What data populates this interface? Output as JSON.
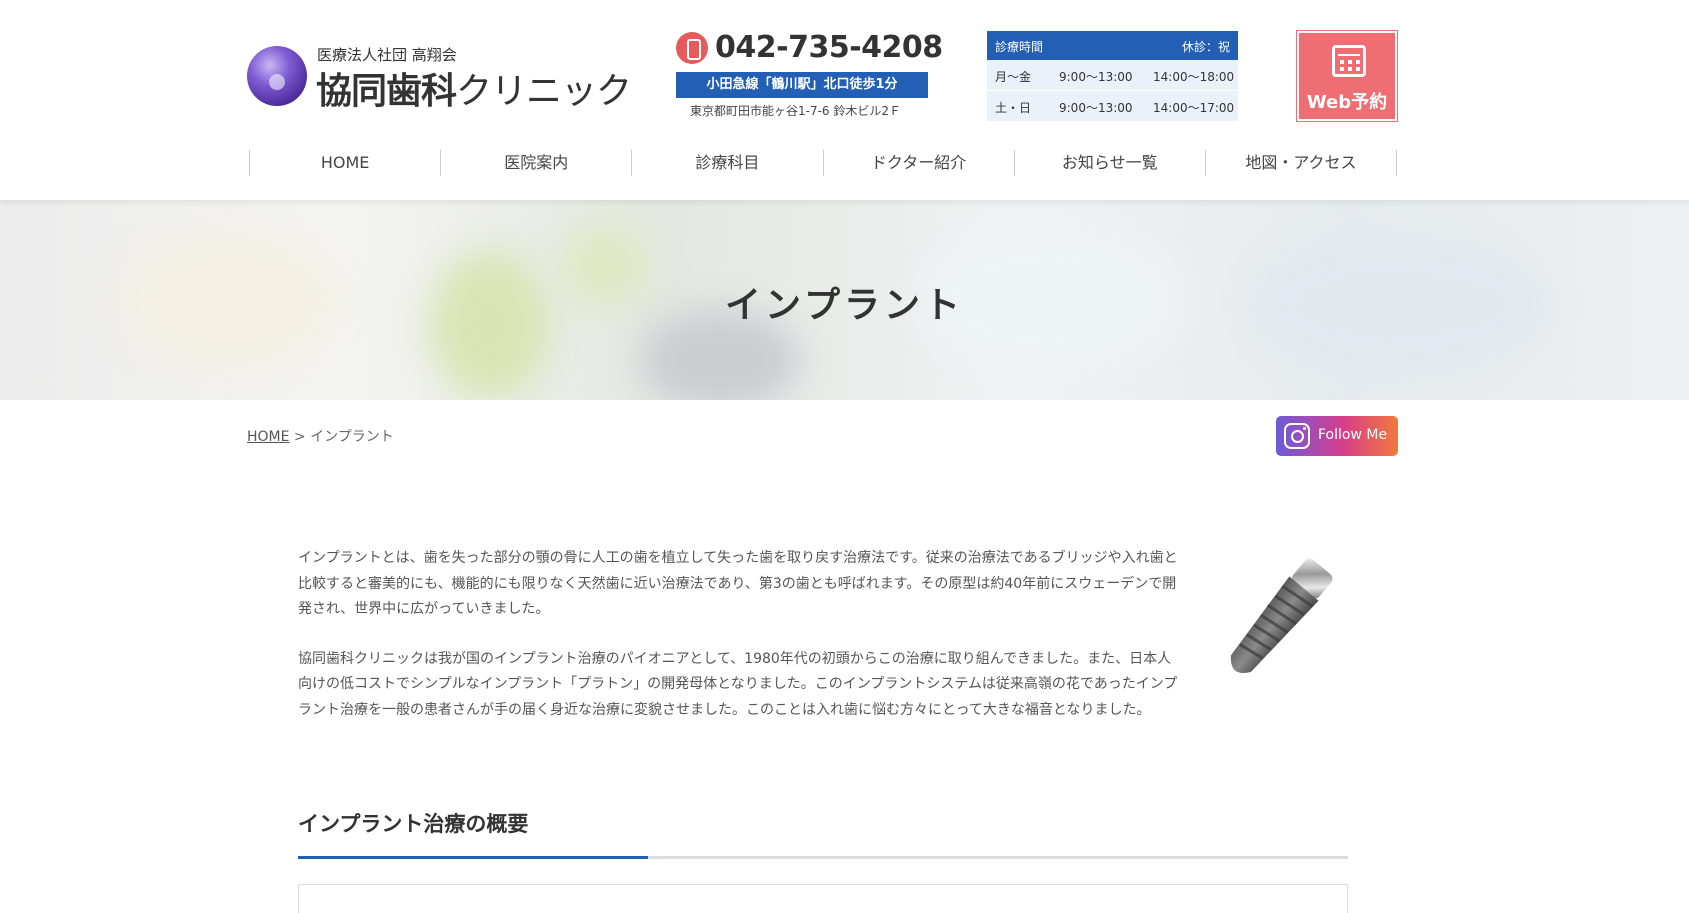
{
  "header": {
    "logo": {
      "corporation": "医療法人社団 高翔会",
      "name_bold": "協同歯科",
      "name_light": "クリニック"
    },
    "phone": "042-735-4208",
    "station": "小田急線「鶴川駅」北口徒歩1分",
    "address": "東京都町田市能ヶ谷1-7-6 鈴木ビル2Ｆ",
    "hours": {
      "label": "診療時間",
      "closed": "休診：祝",
      "rows": [
        {
          "days": "月～金",
          "morning": "9:00～13:00",
          "afternoon": "14:00～18:00"
        },
        {
          "days": "土・日",
          "morning": "9:00～13:00",
          "afternoon": "14:00～17:00"
        }
      ]
    },
    "web_reserve": "Web予約",
    "nav": [
      "HOME",
      "医院案内",
      "診療科目",
      "ドクター紹介",
      "お知らせ一覧",
      "地図・アクセス"
    ]
  },
  "hero": {
    "title": "インプラント"
  },
  "breadcrumb": {
    "home": "HOME",
    "separator": " > ",
    "current": "インプラント"
  },
  "instagram": {
    "label": "Follow Me"
  },
  "intro": {
    "paragraphs": [
      "インプラントとは、歯を失った部分の顎の骨に人工の歯を植立して失った歯を取り戻す治療法です。従来の治療法であるブリッジや入れ歯と比較すると審美的にも、機能的にも限りなく天然歯に近い治療法であり、第3の歯とも呼ばれます。その原型は約40年前にスウェーデンで開発され、世界中に広がっていきました。",
      "協同歯科クリニックは我が国のインプラント治療のパイオニアとして、1980年代の初頭からこの治療に取り組んできました。また、日本人向けの低コストでシンプルなインプラント「プラトン」の開発母体となりました。このインプラントシステムは従来高嶺の花であったインプラント治療を一般の患者さんが手の届く身近な治療に変貌させました。このことは入れ歯に悩む方々にとって大きな福音となりました。"
    ]
  },
  "section": {
    "title": "インプラント治療の概要"
  },
  "colors": {
    "accent_blue": "#2360b5",
    "reserve_red": "#ef6e73",
    "phone_red": "#e55a5a"
  }
}
